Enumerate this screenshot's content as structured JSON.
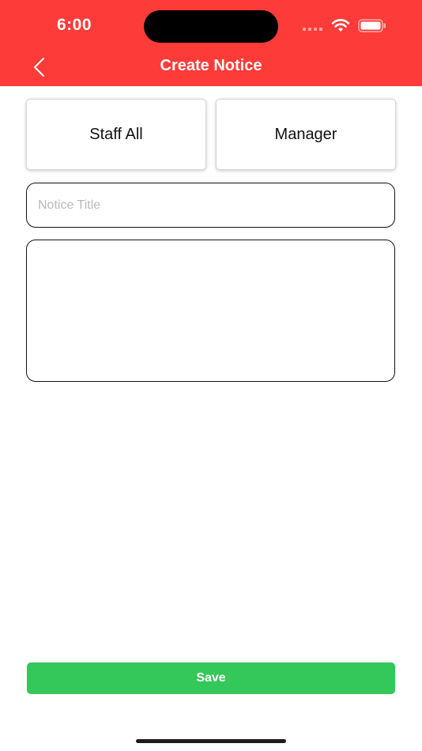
{
  "status_bar": {
    "time": "6:00",
    "icons": [
      "signal-icon",
      "wifi-icon",
      "battery-icon"
    ]
  },
  "header": {
    "title": "Create Notice",
    "back_icon": "chevron-left-icon",
    "background_color": "#fd3b38"
  },
  "roles": {
    "staff_all": "Staff All",
    "manager": "Manager"
  },
  "form": {
    "title_placeholder": "Notice Title",
    "title_value": "",
    "body_value": ""
  },
  "actions": {
    "save_label": "Save",
    "save_color": "#34c759"
  }
}
